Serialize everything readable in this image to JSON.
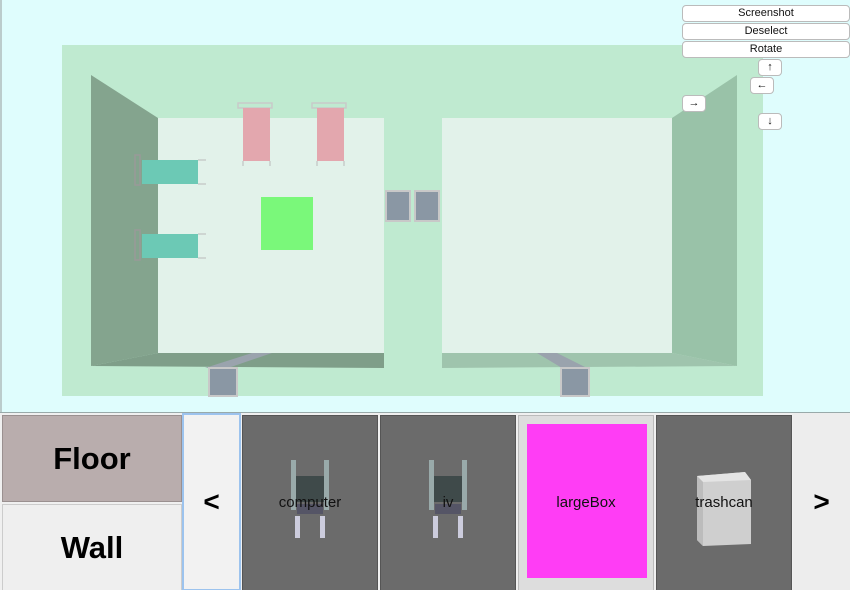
{
  "controls": {
    "screenshot": "Screenshot",
    "deselect": "Deselect",
    "rotate": "Rotate",
    "up": "↑",
    "left": "←",
    "right": "→",
    "down": "↓"
  },
  "modes": {
    "floor": "Floor",
    "wall": "Wall"
  },
  "carousel": {
    "prev": "<",
    "next": ">",
    "items": [
      {
        "label": "computer",
        "icon": "wheelchair-icon",
        "selected": false
      },
      {
        "label": "iv",
        "icon": "wheelchair-icon",
        "selected": false
      },
      {
        "label": "largeBox",
        "icon": "magenta-box-icon",
        "selected": true
      },
      {
        "label": "trashcan",
        "icon": "trashcan-icon",
        "selected": false
      }
    ]
  },
  "colors": {
    "background": "#dffdfd",
    "floor_outer": "#bfead0",
    "room_floor": "#e2f2ea",
    "wall_dark": "#84a48e",
    "bed_pink": "#e3a7ae",
    "bed_teal": "#6cc9b5",
    "selected_tile": "#7af87a",
    "large_box": "#ff3df5"
  }
}
